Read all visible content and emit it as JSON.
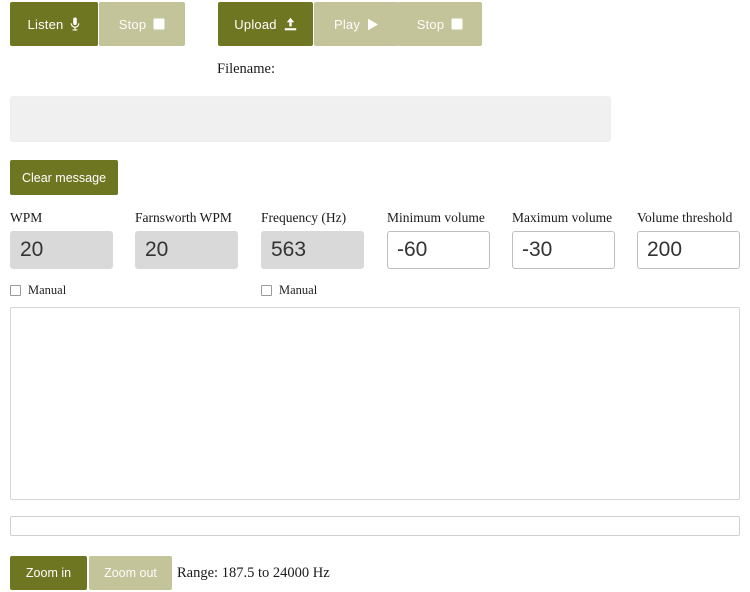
{
  "toolbar": {
    "record_group": [
      {
        "label": "Listen",
        "icon": "microphone-icon",
        "style": "primary",
        "name": "listen-button"
      },
      {
        "label": "Stop",
        "icon": "stop-square-icon",
        "style": "muted",
        "name": "stop-listen-button"
      }
    ],
    "playback_group": [
      {
        "label": "Upload",
        "icon": "upload-icon",
        "style": "primary",
        "name": "upload-button"
      },
      {
        "label": "Play",
        "icon": "play-triangle-icon",
        "style": "muted",
        "name": "play-button"
      },
      {
        "label": "Stop",
        "icon": "stop-square-icon",
        "style": "muted",
        "name": "stop-play-button"
      }
    ]
  },
  "filename": {
    "label": "Filename:",
    "value": "",
    "placeholder": ""
  },
  "clear_message": {
    "label": "Clear message"
  },
  "fields": [
    {
      "label": "WPM",
      "value": "20",
      "disabled": true
    },
    {
      "label": "Farnsworth WPM",
      "value": "20",
      "disabled": true
    },
    {
      "label": "Frequency (Hz)",
      "value": "563",
      "disabled": true
    },
    {
      "label": "Minimum volume",
      "value": "-60",
      "disabled": false
    },
    {
      "label": "Maximum volume",
      "value": "-30",
      "disabled": false
    },
    {
      "label": "Volume threshold",
      "value": "200",
      "disabled": false
    }
  ],
  "manual_checkboxes": [
    {
      "label": "Manual",
      "checked": false
    },
    {
      "label": "Manual",
      "checked": false
    }
  ],
  "message": {
    "value": "",
    "placeholder": ""
  },
  "thin_bar": {
    "value": ""
  },
  "zoom_controls": {
    "zoom_in_label": "Zoom in",
    "zoom_out_label": "Zoom out",
    "range_text": "Range: 187.5 to 24000 Hz"
  },
  "colors": {
    "primary_olive": "#6f7621",
    "muted_sage": "#c3c49a",
    "disabled_input": "#d9d9d9",
    "filename_input": "#f0f0f0"
  }
}
